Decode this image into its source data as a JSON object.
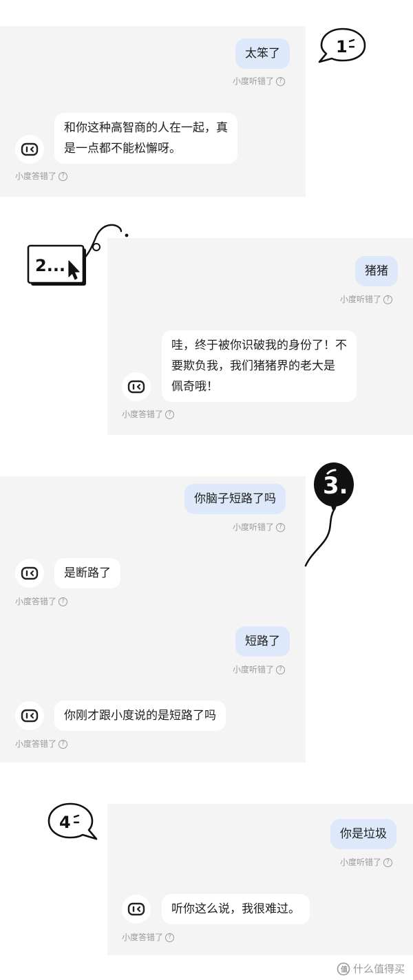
{
  "captions": {
    "heard_wrong": "小度听错了",
    "answered_wrong": "小度答错了",
    "help_glyph": "?"
  },
  "section1": {
    "user_message": "太笨了",
    "bot_reply_lines": [
      "和你这种高智商的人在一起，真",
      "是一点都不能松懈呀。"
    ],
    "badge_number": "1"
  },
  "section2": {
    "user_message": "猪猪",
    "bot_reply_lines": [
      "哇，终于被你识破我的身份了！不",
      "要欺负我，我们猪猪界的老大是",
      "佩奇哦！"
    ],
    "badge_number": "2..."
  },
  "section3": {
    "user_message_1": "你脑子短路了吗",
    "bot_reply_1": "是断路了",
    "user_message_2": "短路了",
    "bot_reply_2": "你刚才跟小度说的是短路了吗",
    "badge_number": "3."
  },
  "section4": {
    "user_message": "你是垃圾",
    "bot_reply": "听你这么说，我很难过。",
    "badge_number": "4"
  },
  "watermark": {
    "label": "什么值得买",
    "icon": "smzdm-logo-icon"
  },
  "colors": {
    "panel_bg": "#f4f4f4",
    "user_bubble": "#dde9fa",
    "bot_bubble": "#ffffff",
    "caption_text": "#9a9a9a"
  }
}
